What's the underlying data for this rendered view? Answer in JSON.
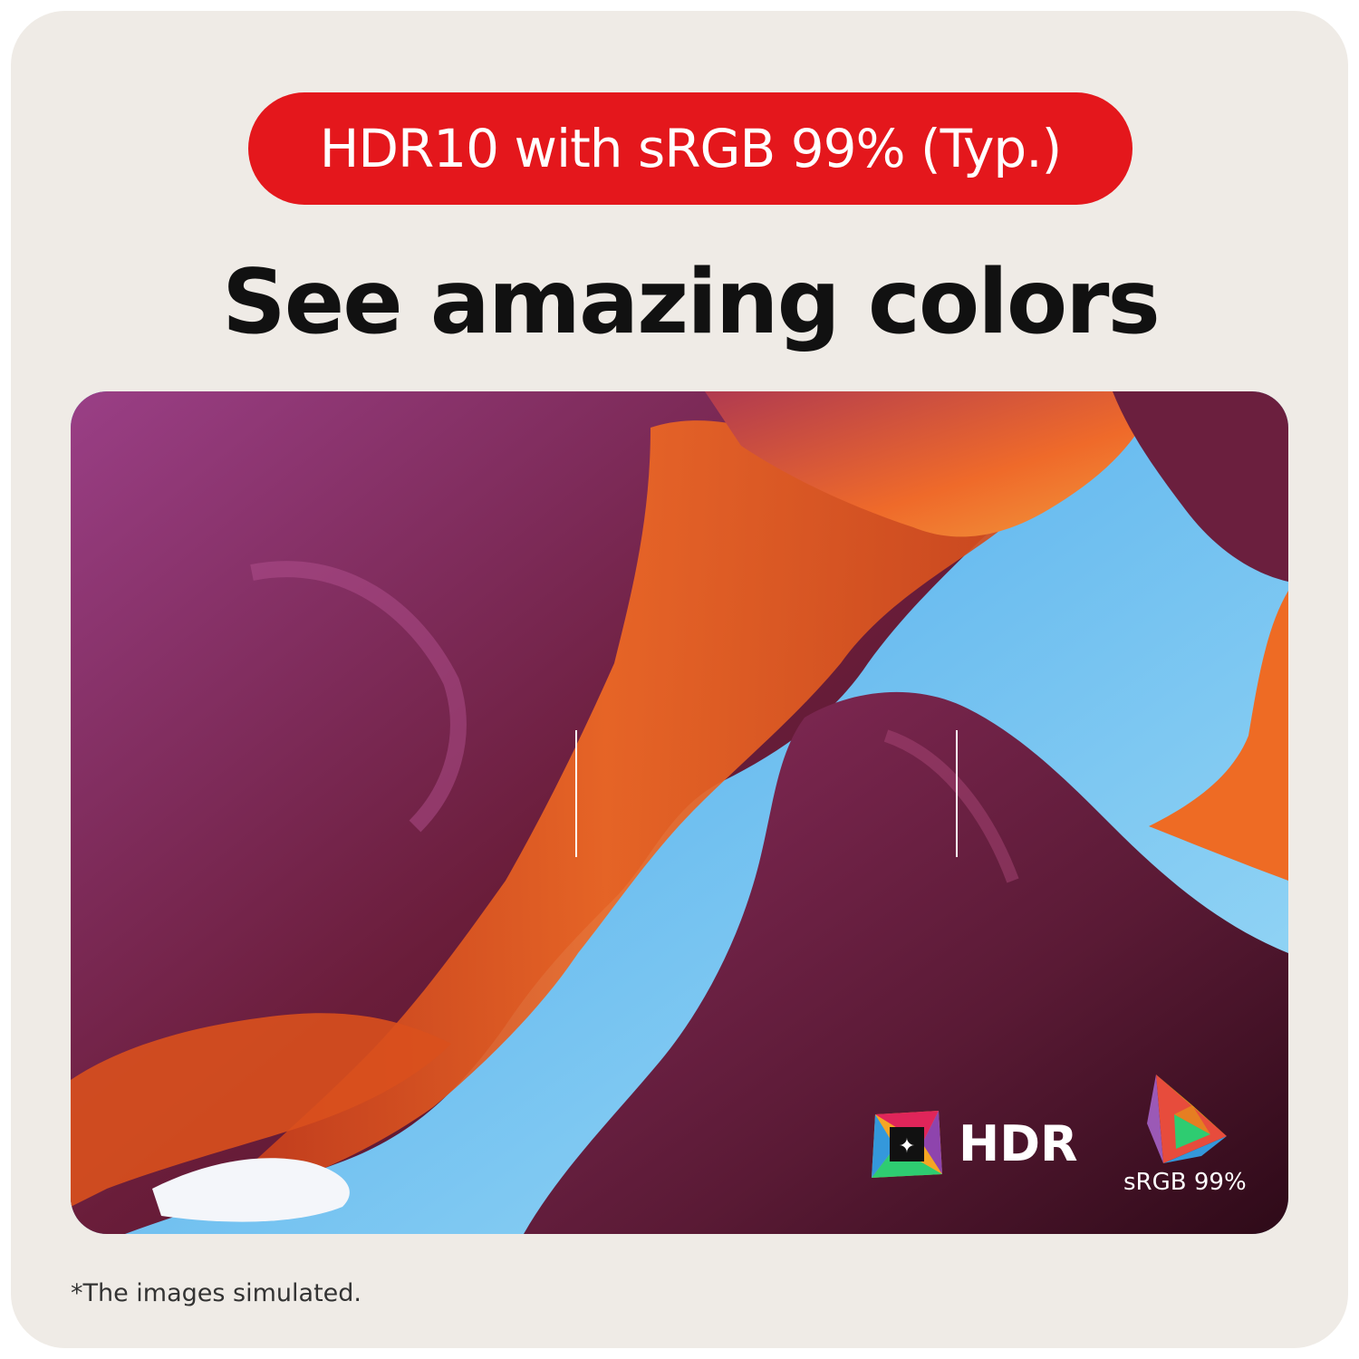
{
  "badge": {
    "text": "HDR10 with sRGB 99% (Typ.)",
    "color": "#e4171c"
  },
  "headline": "See amazing colors",
  "photo": {
    "logos": {
      "hdr_label": "HDR",
      "srgb_label": "sRGB 99%"
    }
  },
  "footnote": "*The images simulated.",
  "colors": {
    "card_background": "#efebe6",
    "sky": "#6ec8ef",
    "rock_orange": "#e8581c",
    "rock_purple": "#7a2758"
  }
}
